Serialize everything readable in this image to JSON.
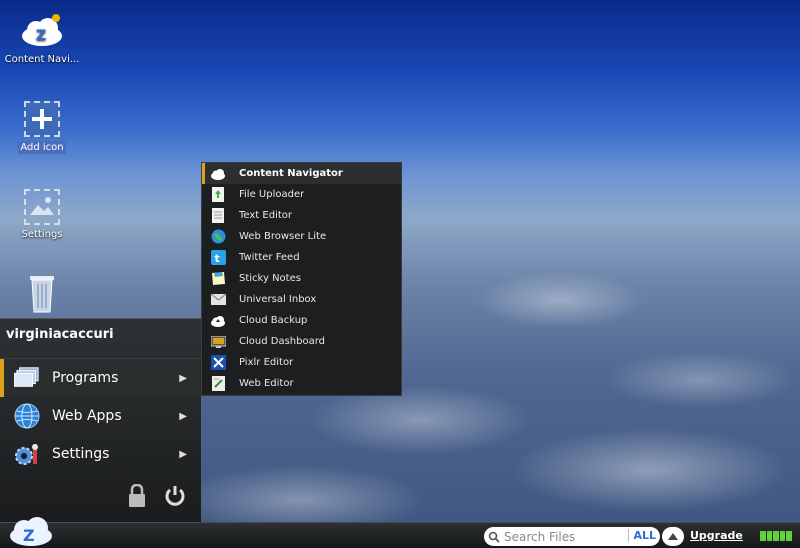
{
  "desktop": {
    "icons": [
      {
        "label": "Content Navi...",
        "icon": "cloud-z-icon"
      },
      {
        "label": "Add icon",
        "icon": "add-icon"
      },
      {
        "label": "Settings",
        "icon": "image-placeholder-icon"
      },
      {
        "label": "",
        "icon": "recycle-bin-icon"
      }
    ]
  },
  "start_menu": {
    "username": "virginiacaccuri",
    "items": [
      {
        "label": "Programs",
        "icon": "programs-icon",
        "active": true
      },
      {
        "label": "Web Apps",
        "icon": "globe-icon"
      },
      {
        "label": "Settings",
        "icon": "gears-icon"
      }
    ],
    "actions": [
      "lock-icon",
      "power-icon"
    ]
  },
  "programs_submenu": {
    "items": [
      {
        "label": "Content Navigator",
        "icon": "cloud-icon",
        "active": true
      },
      {
        "label": "File Uploader",
        "icon": "file-upload-icon"
      },
      {
        "label": "Text Editor",
        "icon": "document-icon"
      },
      {
        "label": "Web Browser Lite",
        "icon": "globe-icon"
      },
      {
        "label": "Twitter Feed",
        "icon": "twitter-icon"
      },
      {
        "label": "Sticky Notes",
        "icon": "sticky-note-icon"
      },
      {
        "label": "Universal Inbox",
        "icon": "envelope-icon"
      },
      {
        "label": "Cloud Backup",
        "icon": "cloud-upload-icon"
      },
      {
        "label": "Cloud Dashboard",
        "icon": "dashboard-icon"
      },
      {
        "label": "Pixlr Editor",
        "icon": "pixlr-icon"
      },
      {
        "label": "Web Editor",
        "icon": "web-editor-icon"
      }
    ]
  },
  "taskbar": {
    "search_placeholder": "Search Files",
    "search_scope": "ALL",
    "upgrade_label": "Upgrade",
    "colors": {
      "accent": "#d9a21a",
      "battery": "#5fd33a"
    }
  }
}
